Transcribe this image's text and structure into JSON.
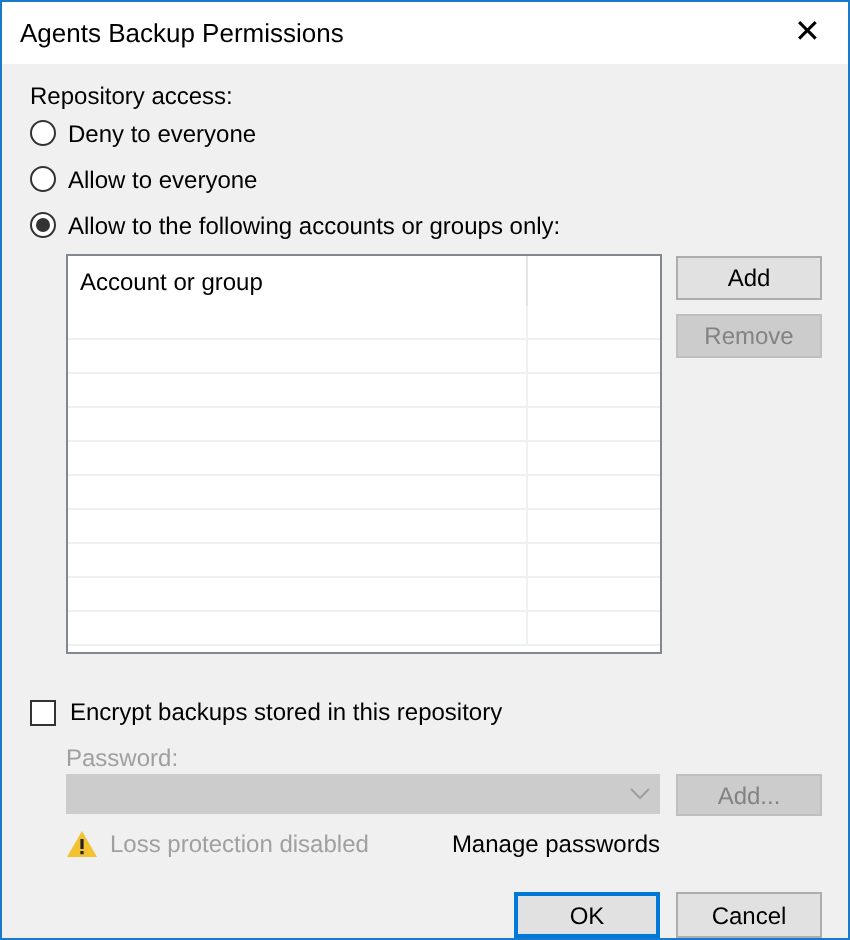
{
  "window": {
    "title": "Agents Backup Permissions",
    "close": "✕"
  },
  "access": {
    "label": "Repository access:",
    "options": [
      {
        "label": "Deny to everyone",
        "selected": false
      },
      {
        "label": "Allow to everyone",
        "selected": false
      },
      {
        "label": "Allow to the following accounts or groups only:",
        "selected": true
      }
    ]
  },
  "accounts_list": {
    "columns": [
      "Account or group"
    ]
  },
  "list_buttons": [
    {
      "label": "Add",
      "disabled": false
    },
    {
      "label": "Remove",
      "disabled": true
    }
  ],
  "encrypt": {
    "label": "Encrypt backups stored in this repository",
    "checked": false
  },
  "password": {
    "label": "Password:",
    "disabled": true,
    "add_button": "Add..."
  },
  "warning": "Loss protection disabled",
  "manage_link": "Manage passwords",
  "footer_buttons": [
    {
      "label": "OK",
      "default": true
    },
    {
      "label": "Cancel",
      "default": false
    }
  ]
}
